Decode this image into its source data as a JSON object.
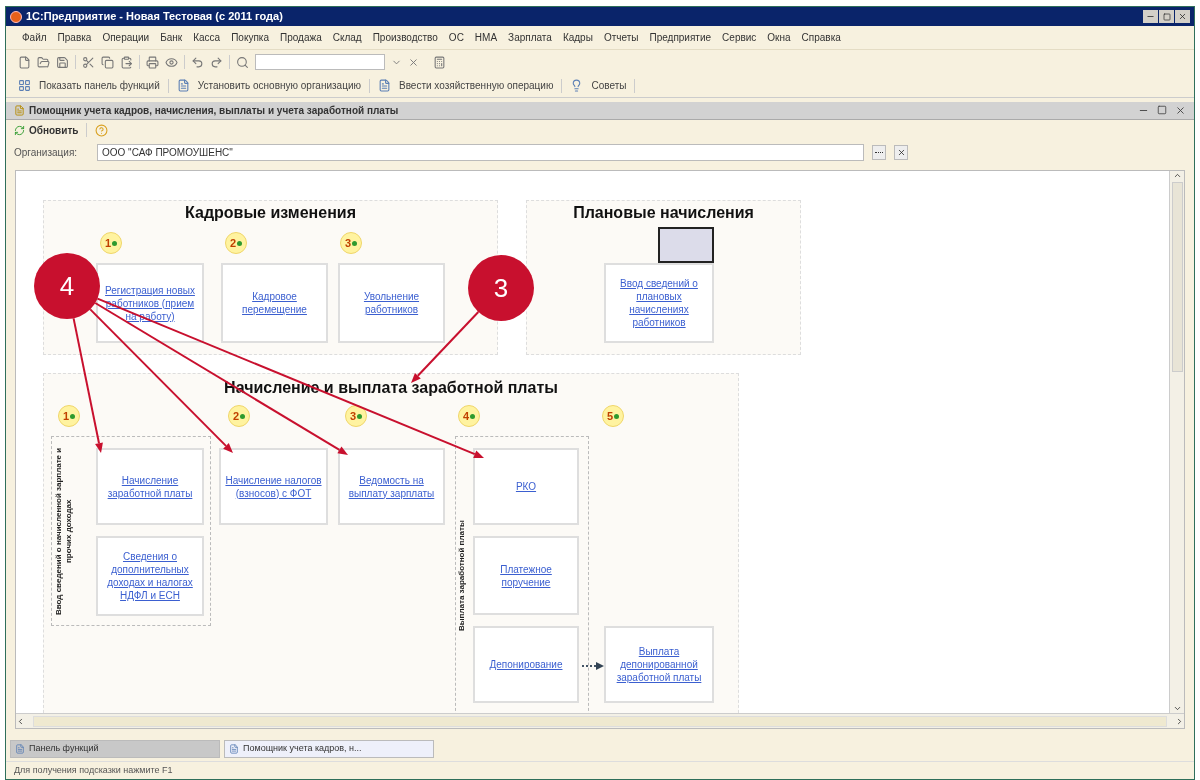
{
  "window": {
    "title": "1С:Предприятие - Новая Тестовая (с 2011 года)"
  },
  "menu": [
    "Файл",
    "Правка",
    "Операции",
    "Банк",
    "Касса",
    "Покупка",
    "Продажа",
    "Склад",
    "Производство",
    "ОС",
    "НМА",
    "Зарплата",
    "Кадры",
    "Отчеты",
    "Предприятие",
    "Сервис",
    "Окна",
    "Справка"
  ],
  "command_bar": [
    "Показать панель функций",
    "Установить основную организацию",
    "Ввести хозяйственную операцию",
    "Советы"
  ],
  "document": {
    "title": "Помощник учета кадров, начисления, выплаты и учета заработной платы",
    "toolbar": [
      "Обновить"
    ],
    "organization": {
      "label": "Организация:",
      "value": "ООО \"САФ ПРОМОУШЕНС\""
    }
  },
  "diagram": {
    "groups": [
      {
        "title": "Кадровые изменения",
        "badges": [
          "1",
          "2",
          "3"
        ],
        "cards": [
          "Регистрация новых работников (прием на работу)",
          "Кадровое перемещение",
          "Увольнение работников"
        ]
      },
      {
        "title": "Плановые начисления",
        "cards": [
          "Ввод сведений о плановых начислениях работников"
        ]
      },
      {
        "title": "Начисление и выплата заработной платы",
        "badges": [
          "1",
          "2",
          "3",
          "4",
          "5"
        ],
        "lanes": [
          "Ввод сведений о начисленной зарплате и прочих доходах",
          "Выплата заработной платы"
        ],
        "cards": [
          "Начисление заработной платы",
          "Сведения о дополнительных доходах и налогах НДФЛ и ЕСН",
          "Начисление налогов (взносов) с ФОТ",
          "Ведомость на выплату зарплаты",
          "РКО",
          "Платежное поручение",
          "Депонирование",
          "Выплата депонированной заработной платы"
        ]
      }
    ]
  },
  "annotations": [
    {
      "label": "4"
    },
    {
      "label": "3"
    }
  ],
  "taskbar": [
    {
      "label": "Панель функций",
      "selected": true
    },
    {
      "label": "Помощник учета кадров, н...",
      "selected": false
    }
  ],
  "status_bar": "Для получения подсказки нажмите F1"
}
